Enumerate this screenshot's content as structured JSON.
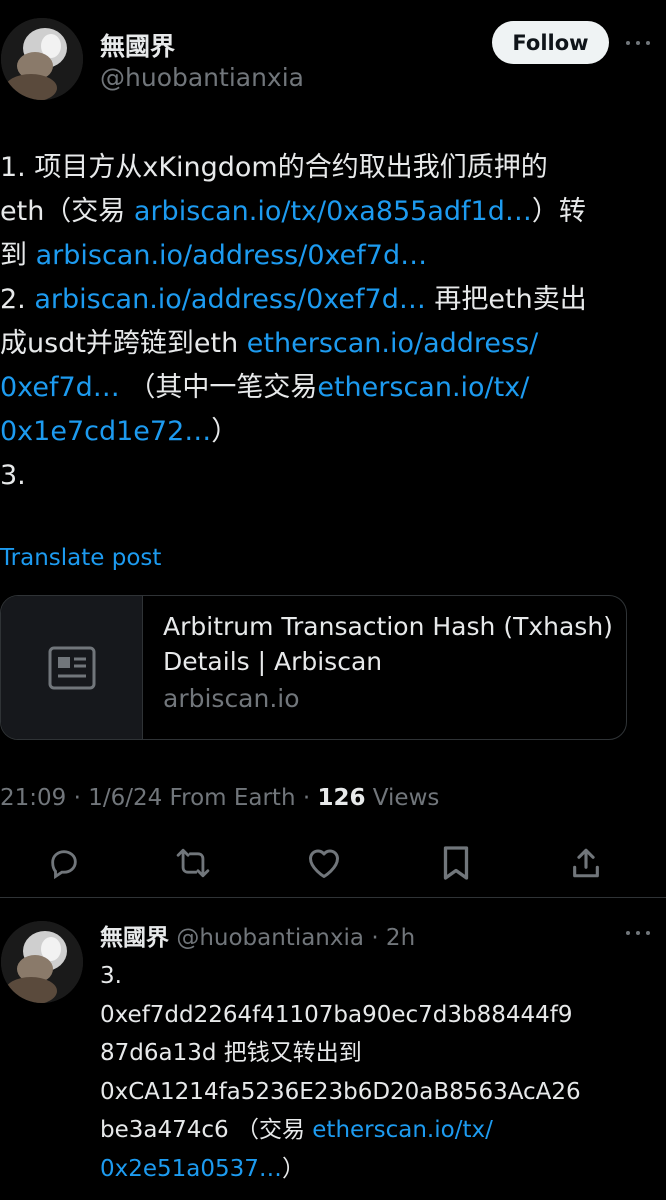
{
  "post": {
    "author_name": "無國界",
    "author_handle": "@huobantianxia",
    "follow_label": "Follow",
    "body_lines": [
      [
        {
          "t": "1. 项目方从xKingdom的合约取出我们质押的",
          "link": false
        }
      ],
      [
        {
          "t": "eth（交易 ",
          "link": false
        },
        {
          "t": "arbiscan.io/tx/0xa855adf1d…",
          "link": true
        },
        {
          "t": "）转",
          "link": false
        }
      ],
      [
        {
          "t": "到 ",
          "link": false
        },
        {
          "t": "arbiscan.io/address/0xef7d…",
          "link": true
        }
      ],
      [
        {
          "t": "2. ",
          "link": false
        },
        {
          "t": "arbiscan.io/address/0xef7d…",
          "link": true
        },
        {
          "t": " 再把eth卖出",
          "link": false
        }
      ],
      [
        {
          "t": "成usdt并跨链到eth ",
          "link": false
        },
        {
          "t": "etherscan.io/address/",
          "link": true
        }
      ],
      [
        {
          "t": "0xef7d…",
          "link": true
        },
        {
          "t": " （其中一笔交易",
          "link": false
        },
        {
          "t": "etherscan.io/tx/",
          "link": true
        }
      ],
      [
        {
          "t": "0x1e7cd1e72…",
          "link": true
        },
        {
          "t": "）",
          "link": false
        }
      ],
      [
        {
          "t": "3.",
          "link": false
        }
      ]
    ],
    "translate_label": "Translate post",
    "card": {
      "title_line1": "Arbitrum Transaction Hash (Txhash)",
      "title_line2": "Details | Arbiscan",
      "domain": "arbiscan.io",
      "thumb_icon": "article-icon"
    },
    "timestamp": "21:09 · 1/6/24 From Earth · ",
    "views_count": "126",
    "views_label": " Views",
    "actions": [
      "reply-icon",
      "retweet-icon",
      "like-icon",
      "bookmark-icon",
      "share-icon"
    ]
  },
  "reply": {
    "author_name": "無國界",
    "author_handle": "@huobantianxia",
    "time_ago": "· 2h",
    "body_lines": [
      [
        {
          "t": "3.",
          "link": false
        }
      ],
      [
        {
          "t": "0xef7dd2264f41107ba90ec7d3b88444f9",
          "link": false
        }
      ],
      [
        {
          "t": "87d6a13d 把钱又转出到",
          "link": false
        }
      ],
      [
        {
          "t": "0xCA1214fa5236E23b6D20aB8563AcA26",
          "link": false
        }
      ],
      [
        {
          "t": "be3a474c6 （交易 ",
          "link": false
        },
        {
          "t": "etherscan.io/tx/",
          "link": true
        }
      ],
      [
        {
          "t": "0x2e51a0537…",
          "link": true
        },
        {
          "t": "）",
          "link": false
        }
      ]
    ]
  },
  "colors": {
    "background": "#000000",
    "text": "#e7e9ea",
    "link": "#1d9bf0",
    "secondary": "#71767b",
    "border": "#2f3336"
  }
}
